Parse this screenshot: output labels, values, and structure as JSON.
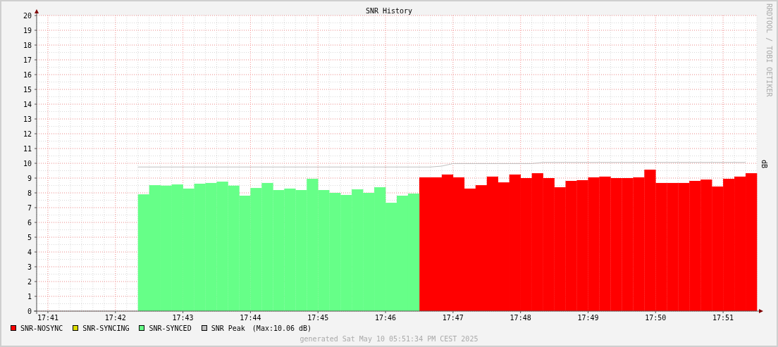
{
  "chart": {
    "chart_data": {
      "type": "bar",
      "title": "SNR History",
      "ylabel": "dB",
      "stacked": true,
      "grid": true,
      "categories": [
        null,
        "17:41",
        null,
        null,
        null,
        null,
        null,
        "17:42",
        null,
        null,
        null,
        null,
        null,
        "17:43",
        null,
        null,
        null,
        null,
        null,
        "17:44",
        null,
        null,
        null,
        null,
        null,
        "17:45",
        null,
        null,
        null,
        null,
        null,
        "17:46",
        null,
        null,
        null,
        null,
        null,
        "17:47",
        null,
        null,
        null,
        null,
        null,
        "17:48",
        null,
        null,
        null,
        null,
        null,
        "17:49",
        null,
        null,
        null,
        null,
        null,
        "17:50",
        null,
        null,
        null,
        null,
        null,
        "17:51",
        null,
        null
      ],
      "series": [
        {
          "name": "SNR-NOSYNC",
          "color": "#ff0000",
          "values": [
            null,
            null,
            null,
            null,
            null,
            null,
            null,
            null,
            null,
            null,
            null,
            null,
            null,
            null,
            null,
            null,
            null,
            null,
            null,
            null,
            null,
            null,
            null,
            null,
            null,
            null,
            null,
            null,
            null,
            null,
            null,
            null,
            null,
            null,
            9.05,
            9.05,
            9.24,
            9.05,
            8.29,
            8.52,
            9.1,
            8.71,
            9.24,
            9.0,
            9.33,
            9.0,
            8.38,
            8.81,
            8.86,
            9.05,
            9.1,
            9.0,
            9.0,
            9.05,
            9.57,
            8.67,
            8.67,
            8.67,
            8.81,
            8.9,
            8.43,
            8.95,
            9.1,
            9.33
          ]
        },
        {
          "name": "SNR-SYNCING",
          "color": "#dddd00",
          "values": [
            null,
            null,
            null,
            null,
            null,
            null,
            null,
            null,
            null,
            null,
            null,
            null,
            null,
            null,
            null,
            null,
            null,
            null,
            null,
            null,
            null,
            null,
            null,
            null,
            null,
            null,
            null,
            null,
            null,
            null,
            null,
            null,
            null,
            null,
            null,
            null,
            null,
            null,
            null,
            null,
            null,
            null,
            null,
            null,
            null,
            null,
            null,
            null,
            null,
            null,
            null,
            null,
            null,
            null,
            null,
            null,
            null,
            null,
            null,
            null,
            null,
            null,
            null,
            null
          ]
        },
        {
          "name": "SNR-SYNCED",
          "color": "#66ff88",
          "values": [
            null,
            null,
            null,
            null,
            null,
            null,
            null,
            null,
            null,
            7.9,
            8.52,
            8.49,
            8.57,
            8.29,
            8.62,
            8.67,
            8.76,
            8.49,
            7.81,
            8.33,
            8.67,
            8.19,
            8.29,
            8.19,
            8.95,
            8.19,
            8.0,
            7.86,
            8.24,
            8.0,
            8.38,
            7.33,
            7.81,
            7.95,
            null,
            null,
            null,
            null,
            null,
            null,
            null,
            null,
            null,
            null,
            null,
            null,
            null,
            null,
            null,
            null,
            null,
            null,
            null,
            null,
            null,
            null,
            null,
            null,
            null,
            null,
            null,
            null,
            null,
            null
          ]
        },
        {
          "name": "SNR Peak",
          "color": "#c0c0c0",
          "type": "line",
          "values": [
            null,
            null,
            null,
            null,
            null,
            null,
            null,
            null,
            null,
            9.75,
            9.75,
            9.75,
            9.75,
            9.75,
            9.75,
            9.75,
            9.75,
            9.75,
            9.75,
            9.75,
            9.75,
            9.75,
            9.75,
            9.75,
            9.75,
            9.75,
            9.75,
            9.75,
            9.75,
            9.75,
            9.75,
            9.75,
            9.75,
            9.75,
            9.75,
            9.75,
            9.81,
            9.98,
            9.98,
            9.98,
            9.98,
            9.98,
            9.98,
            9.98,
            9.98,
            10.06,
            10.06,
            10.06,
            10.06,
            10.06,
            10.06,
            10.06,
            10.06,
            10.06,
            10.06,
            10.06,
            10.06,
            10.06,
            10.06,
            10.06,
            10.06,
            10.06,
            10.06,
            10.06
          ]
        }
      ],
      "ylim": [
        0,
        20
      ],
      "yticks": [
        0,
        1,
        2,
        3,
        4,
        5,
        6,
        7,
        8,
        9,
        10,
        11,
        12,
        13,
        14,
        15,
        16,
        17,
        18,
        19,
        20
      ]
    },
    "credit": "RRDTOOL / TOBI OETIKER"
  },
  "legend_note": "(Max:10.06 dB)",
  "footer": "generated Sat May 10 05:51:34 PM CEST 2025"
}
